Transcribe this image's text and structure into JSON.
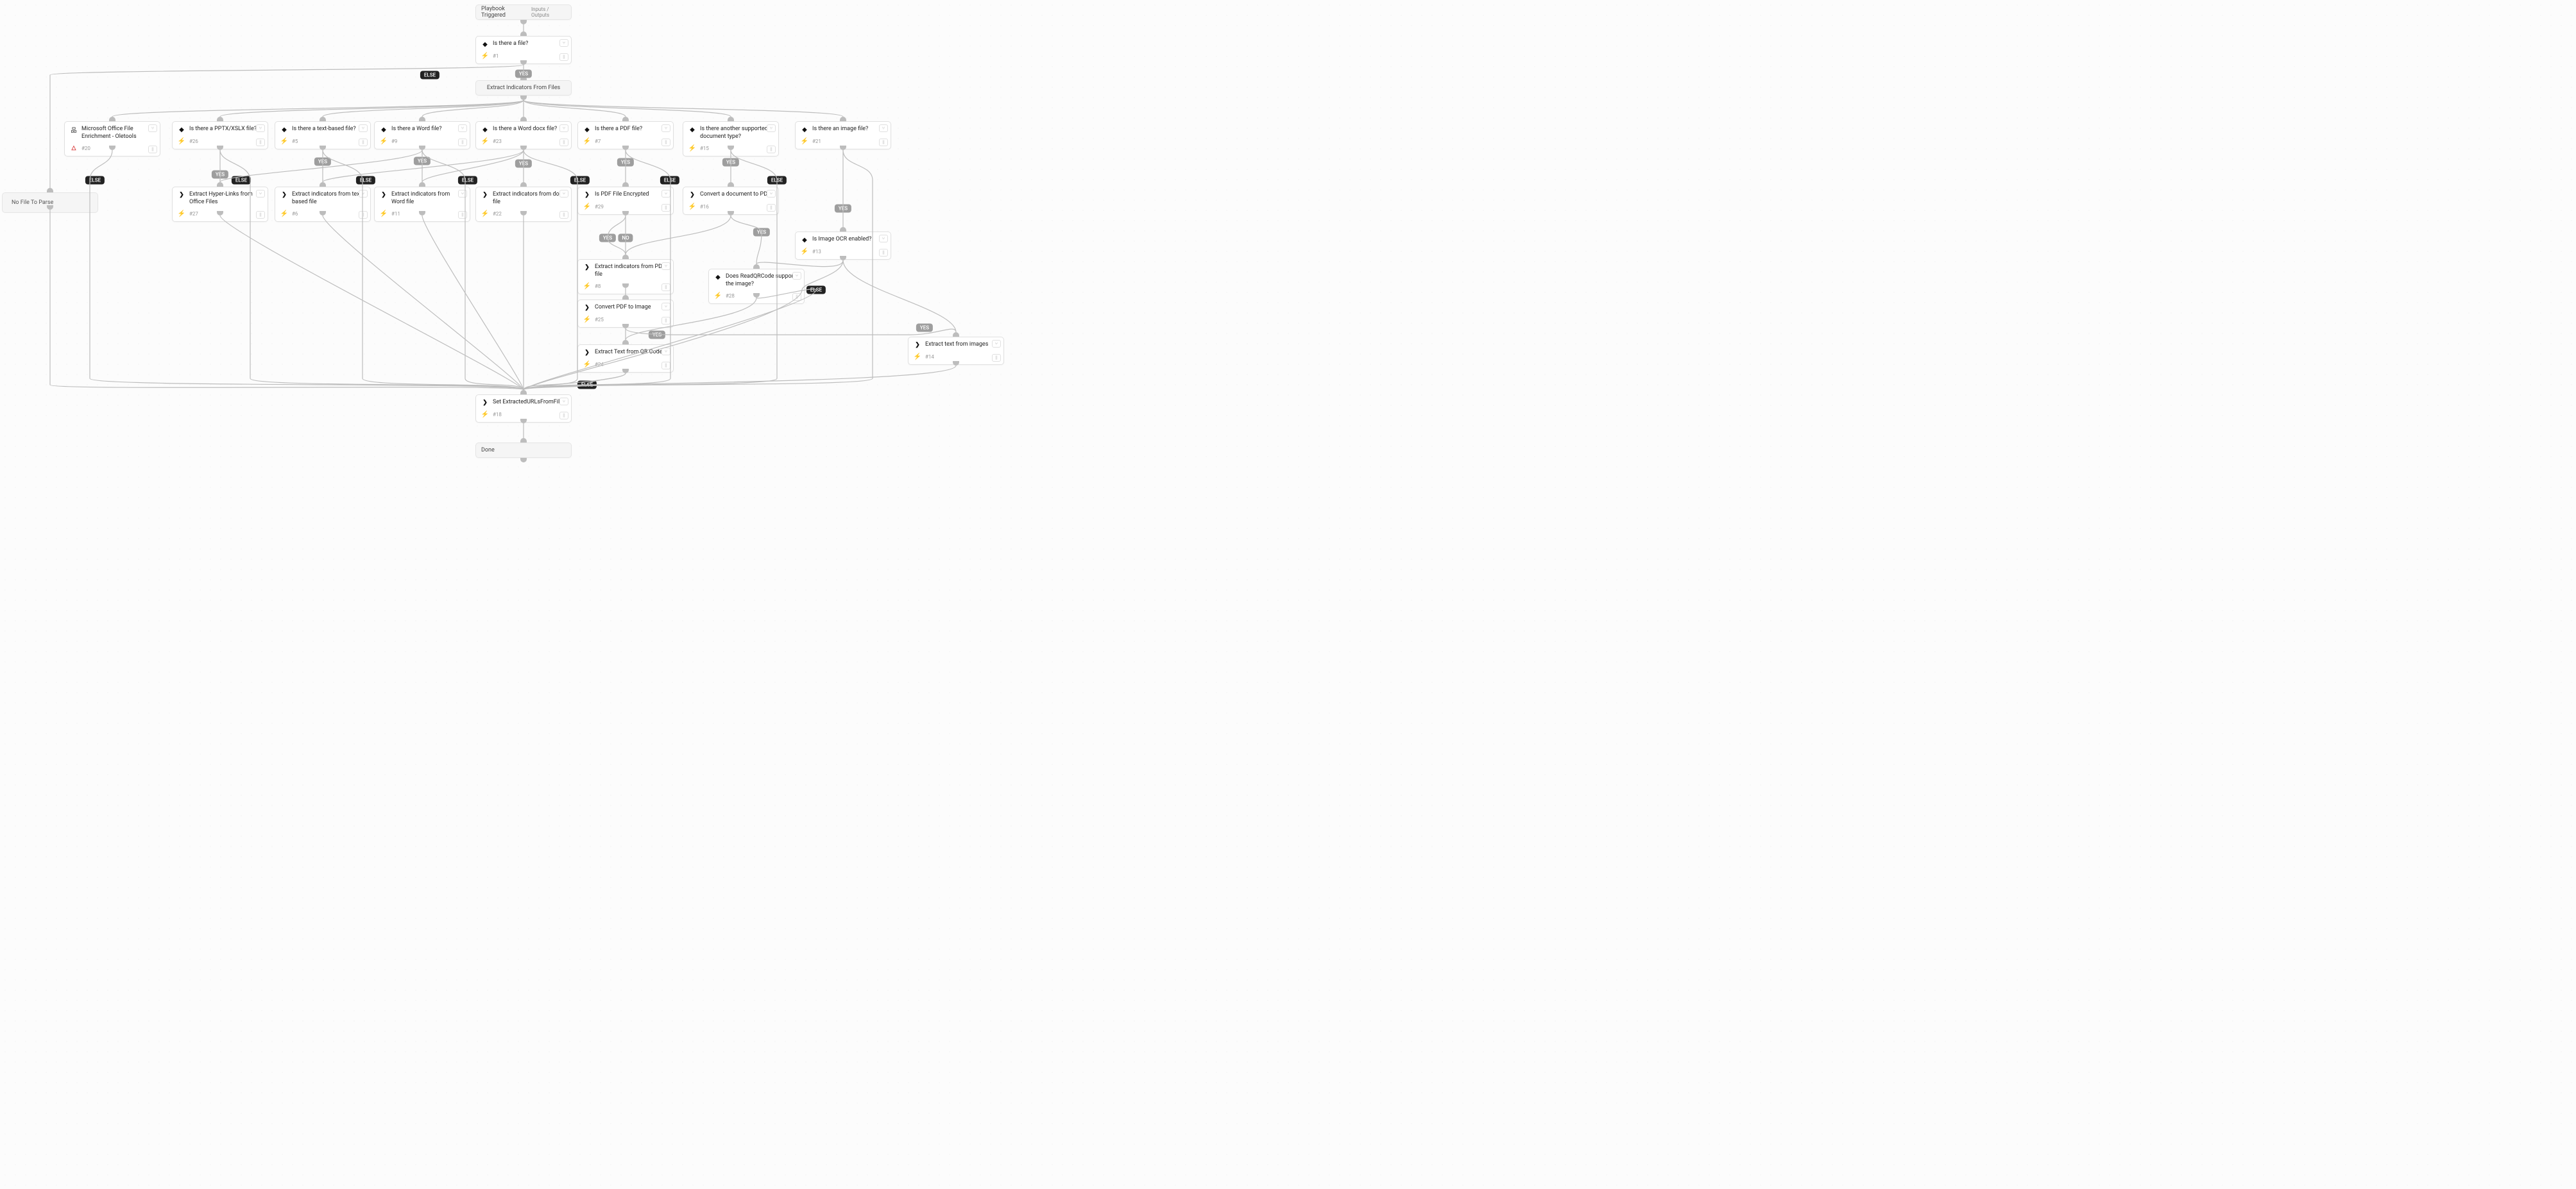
{
  "trigger": {
    "title": "Playbook Triggered",
    "io": "Inputs / Outputs"
  },
  "section_extract": "Extract Indicators From Files",
  "no_file": "No File To Parse",
  "done": "Done",
  "labels": {
    "yes": "YES",
    "no": "NO",
    "else": "ELSE"
  },
  "btn": {
    "branch": "⑂",
    "pause": "||"
  },
  "nodes": {
    "n1": {
      "title": "Is there a file?",
      "id": "#1",
      "icon1": "diamond",
      "icon2": "bolt"
    },
    "n20": {
      "title": "Microsoft Office File Enrichment - Oletools",
      "id": "#20",
      "icon1": "doc",
      "icon2": "warn"
    },
    "n26": {
      "title": "Is there a PPTX/XSLX file?",
      "id": "#26",
      "icon1": "diamond",
      "icon2": "bolt"
    },
    "n5": {
      "title": "Is there a text-based file?",
      "id": "#5",
      "icon1": "diamond",
      "icon2": "bolt"
    },
    "n9": {
      "title": "Is there a Word file?",
      "id": "#9",
      "icon1": "diamond",
      "icon2": "bolt"
    },
    "n23": {
      "title": "Is there a Word docx file?",
      "id": "#23",
      "icon1": "diamond",
      "icon2": "bolt"
    },
    "n7": {
      "title": "Is there a PDF file?",
      "id": "#7",
      "icon1": "diamond",
      "icon2": "bolt"
    },
    "n15": {
      "title": "Is there another supported document type?",
      "id": "#15",
      "icon1": "diamond",
      "icon2": "bolt"
    },
    "n21": {
      "title": "Is there an image file?",
      "id": "#21",
      "icon1": "diamond",
      "icon2": "bolt"
    },
    "n27": {
      "title": "Extract Hyper-Links from Office Files",
      "id": "#27",
      "icon1": "chev",
      "icon2": "bolt"
    },
    "n6": {
      "title": "Extract indicators from text-based file",
      "id": "#6",
      "icon1": "chev",
      "icon2": "bolt"
    },
    "n11": {
      "title": "Extract indicators from Word file",
      "id": "#11",
      "icon1": "chev",
      "icon2": "bolt"
    },
    "n22": {
      "title": "Extract indicators from docx file",
      "id": "#22",
      "icon1": "chev",
      "icon2": "bolt"
    },
    "n29": {
      "title": "Is PDF File Encrypted",
      "id": "#29",
      "icon1": "chev",
      "icon2": "bolt"
    },
    "n16": {
      "title": "Convert a document to PDF",
      "id": "#16",
      "icon1": "chev",
      "icon2": "bolt"
    },
    "n13": {
      "title": "Is Image OCR enabled?",
      "id": "#13",
      "icon1": "diamond",
      "icon2": "bolt"
    },
    "n8": {
      "title": "Extract indicators from PDF file",
      "id": "#8",
      "icon1": "chev",
      "icon2": "bolt"
    },
    "n28": {
      "title": "Does ReadQRCode support the image?",
      "id": "#28",
      "icon1": "diamond",
      "icon2": "bolt"
    },
    "n25": {
      "title": "Convert PDF to Image",
      "id": "#25",
      "icon1": "chev",
      "icon2": "bolt"
    },
    "n24": {
      "title": "Extract Text from QR Code",
      "id": "#24",
      "icon1": "chev",
      "icon2": "bolt"
    },
    "n14": {
      "title": "Extract text from images",
      "id": "#14",
      "icon1": "chev",
      "icon2": "bolt"
    },
    "n18": {
      "title": "Set ExtractedURLsFromFiles",
      "id": "#18",
      "icon1": "chev",
      "icon2": "bolt"
    }
  }
}
